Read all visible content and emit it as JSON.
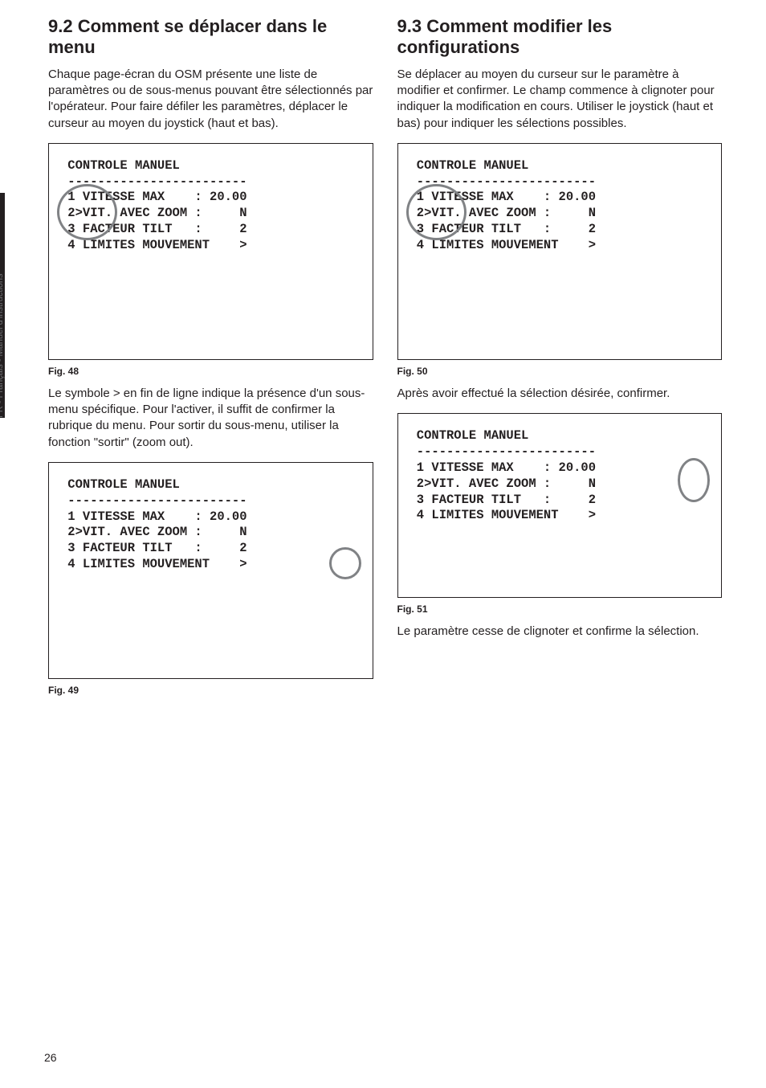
{
  "sideTab": "FR - Français - Manuel d'instructions",
  "pageNumber": "26",
  "left": {
    "heading": "9.2  Comment se déplacer dans le menu",
    "intro": "Chaque page-écran du OSM présente une liste de paramètres ou de sous-menus pouvant être sélectionnés par l'opérateur. Pour faire défiler les paramètres, déplacer le curseur au moyen du joystick (haut et bas).",
    "screen1": " CONTROLE MANUEL\n ------------------------\n 1 VITESSE MAX    : 20.00\n 2>VIT. AVEC ZOOM :     N\n 3 FACTEUR TILT   :     2\n 4 LIMITES MOUVEMENT    >",
    "cap1": "Fig. 48",
    "mid": "Le symbole > en fin de ligne indique la présence d'un sous-menu spécifique. Pour l'activer, il suffit de confirmer la rubrique du menu. Pour sortir du sous-menu, utiliser la fonction \"sortir\" (zoom out).",
    "screen2": " CONTROLE MANUEL\n ------------------------\n 1 VITESSE MAX    : 20.00\n 2>VIT. AVEC ZOOM :     N\n 3 FACTEUR TILT   :     2\n 4 LIMITES MOUVEMENT    >",
    "cap2": "Fig. 49"
  },
  "right": {
    "heading": "9.3  Comment modifier les configurations",
    "intro": "Se déplacer au moyen du curseur sur le paramètre à modifier et confirmer. Le champ commence à clignoter pour indiquer la modification en cours. Utiliser le joystick (haut et bas) pour indiquer les sélections possibles.",
    "screen1": " CONTROLE MANUEL\n ------------------------\n 1 VITESSE MAX    : 20.00\n 2>VIT. AVEC ZOOM :     N\n 3 FACTEUR TILT   :     2\n 4 LIMITES MOUVEMENT    >",
    "cap1": "Fig. 50",
    "mid": "Après avoir effectué la sélection désirée, confirmer.",
    "screen2": " CONTROLE MANUEL\n ------------------------\n 1 VITESSE MAX    : 20.00\n 2>VIT. AVEC ZOOM :     N\n 3 FACTEUR TILT   :     2\n 4 LIMITES MOUVEMENT    >",
    "cap2": "Fig. 51",
    "outro": "Le paramètre cesse de clignoter et confirme la sélection."
  }
}
